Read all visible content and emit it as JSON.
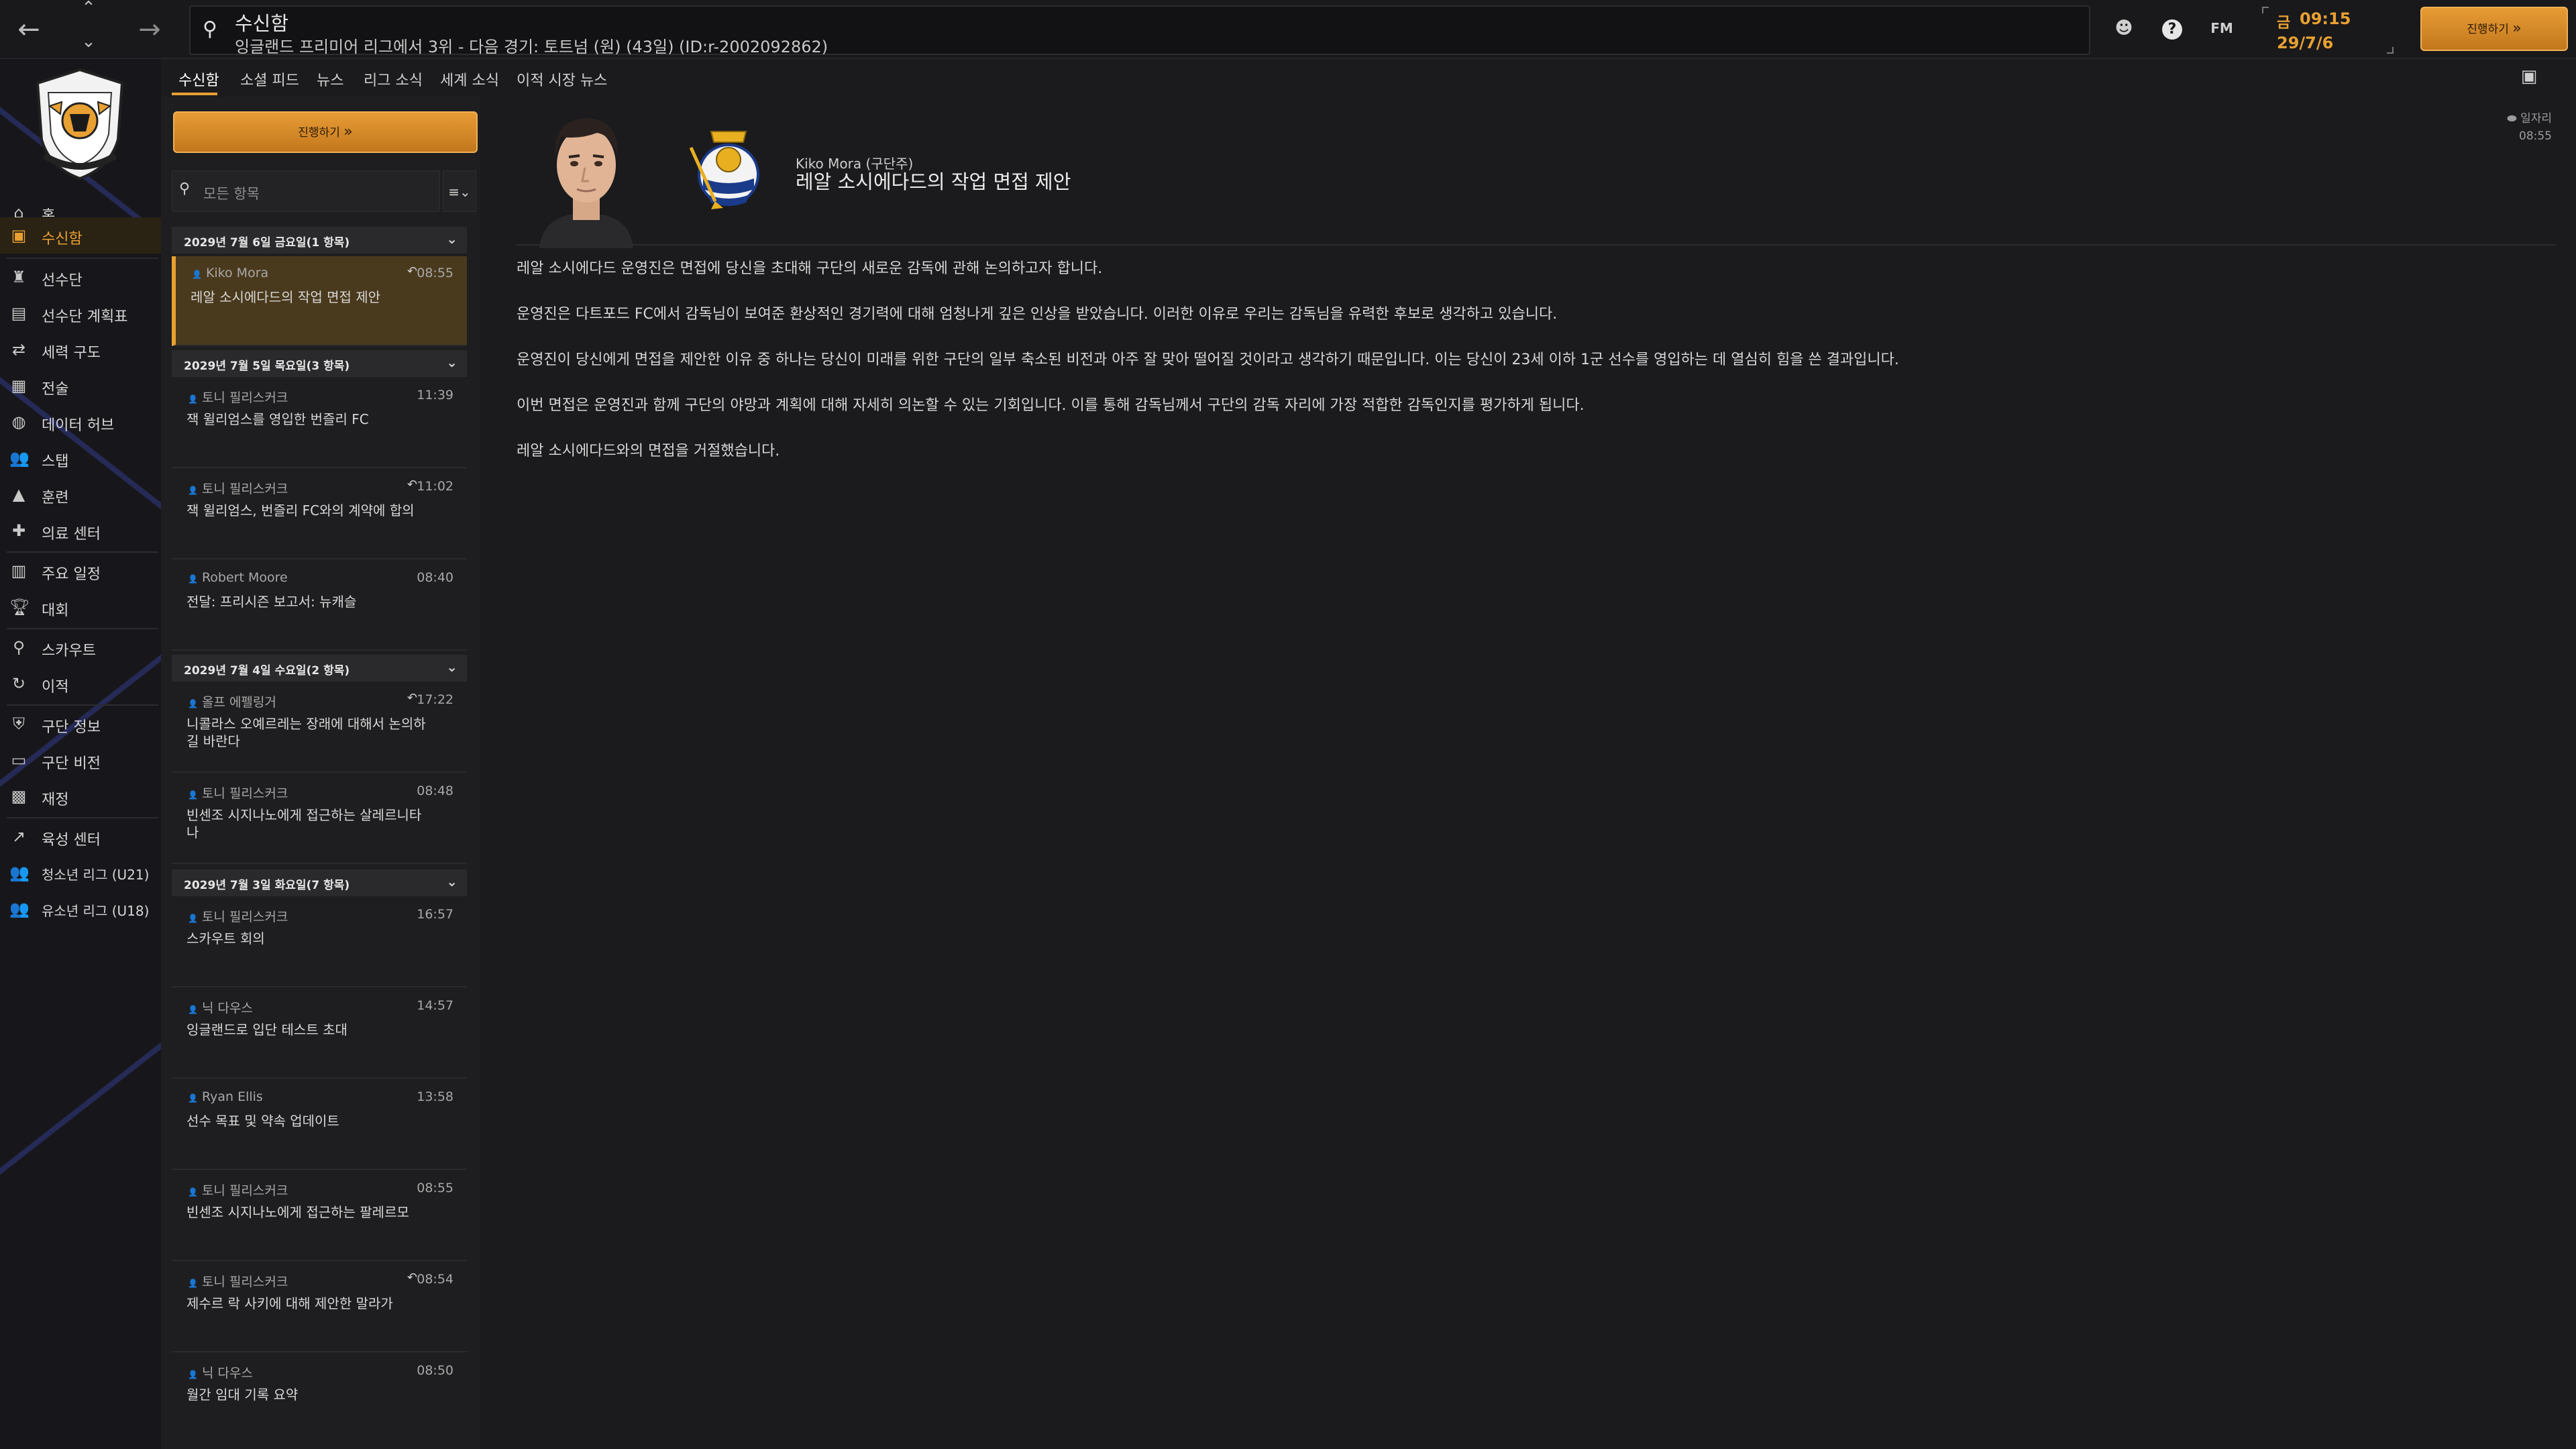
{
  "header": {
    "title": "수신함",
    "subtitle": "잉글랜드 프리미어 리그에서 3위 - 다음 경기: 토트넘 (원) (43일) (ID:r-2002092862)",
    "fm_label": "FM",
    "day": "금",
    "time": "09:15",
    "date": "29/7/6",
    "continue_label": "진행하기"
  },
  "sidebar": {
    "items": [
      {
        "label": "홈",
        "icon": "home-icon"
      },
      {
        "label": "수신함",
        "icon": "inbox-icon"
      },
      {
        "label": "선수단",
        "icon": "shirt-icon"
      },
      {
        "label": "선수단 계획표",
        "icon": "clipboard-icon"
      },
      {
        "label": "세력 구도",
        "icon": "hierarchy-icon"
      },
      {
        "label": "전술",
        "icon": "tactics-icon"
      },
      {
        "label": "데이터 허브",
        "icon": "data-hub-icon"
      },
      {
        "label": "스탭",
        "icon": "staff-icon"
      },
      {
        "label": "훈련",
        "icon": "training-icon"
      },
      {
        "label": "의료 센터",
        "icon": "medical-icon"
      },
      {
        "label": "주요 일정",
        "icon": "calendar-icon"
      },
      {
        "label": "대회",
        "icon": "trophy-icon"
      },
      {
        "label": "스카우트",
        "icon": "scouting-icon"
      },
      {
        "label": "이적",
        "icon": "transfer-icon"
      },
      {
        "label": "구단 정보",
        "icon": "shield-icon"
      },
      {
        "label": "구단 비전",
        "icon": "briefcase-icon"
      },
      {
        "label": "재정",
        "icon": "finance-icon"
      },
      {
        "label": "육성 센터",
        "icon": "development-icon"
      },
      {
        "label": "청소년 리그 (U21)",
        "icon": "u21-icon"
      },
      {
        "label": "유소년 리그 (U18)",
        "icon": "u18-icon"
      }
    ]
  },
  "tabs": [
    "수신함",
    "소셜 피드",
    "뉴스",
    "리그 소식",
    "세계 소식",
    "이적 시장 뉴스"
  ],
  "list": {
    "continue_label": "진행하기",
    "filter_placeholder": "모든 항목",
    "groups": [
      {
        "header": "2029년 7월 6일 금요일(1 항목)",
        "messages": [
          {
            "sender": "Kiko Mora",
            "time": "08:55",
            "subject": "레알 소시에다드의 작업 면접 제안",
            "reply": true
          }
        ]
      },
      {
        "header": "2029년 7월 5일 목요일(3 항목)",
        "messages": [
          {
            "sender": "토니 필리스커크",
            "time": "11:39",
            "subject": "잭 윌리엄스를 영입한 번즐리 FC",
            "reply": false
          },
          {
            "sender": "토니 필리스커크",
            "time": "11:02",
            "subject": "잭 윌리엄스, 번즐리 FC와의 계약에 합의",
            "reply": true
          },
          {
            "sender": "Robert Moore",
            "time": "08:40",
            "subject": "전달: 프리시즌 보고서: 뉴캐슬",
            "reply": false
          }
        ]
      },
      {
        "header": "2029년 7월 4일 수요일(2 항목)",
        "messages": [
          {
            "sender": "올프 에펠링거",
            "time": "17:22",
            "subject": "니콜라스 오예르레는 장래에 대해서 논의하길 바란다",
            "reply": true
          },
          {
            "sender": "토니 필리스커크",
            "time": "08:48",
            "subject": "빈센조 시지나노에게 접근하는 살레르니타나",
            "reply": false
          }
        ]
      },
      {
        "header": "2029년 7월 3일 화요일(7 항목)",
        "messages": [
          {
            "sender": "토니 필리스커크",
            "time": "16:57",
            "subject": "스카우트 회의",
            "reply": false
          },
          {
            "sender": "닉 다우스",
            "time": "14:57",
            "subject": "잉글랜드로 입단 테스트 초대",
            "reply": false
          },
          {
            "sender": "Ryan Ellis",
            "time": "13:58",
            "subject": "선수 목표 및 약속 업데이트",
            "reply": false
          },
          {
            "sender": "토니 필리스커크",
            "time": "08:55",
            "subject": "빈센조 시지나노에게 접근하는 팔레르모",
            "reply": false
          },
          {
            "sender": "토니 필리스커크",
            "time": "08:54",
            "subject": "제수르 락 사키에 대해 제안한 말라가",
            "reply": true
          },
          {
            "sender": "닉 다우스",
            "time": "08:50",
            "subject": "월간 임대 기록 요약",
            "reply": false
          }
        ]
      }
    ]
  },
  "mail": {
    "from": "Kiko Mora (구단주)",
    "title": "레알 소시에다드의 작업 면접 제안",
    "meta_label": "일자리",
    "meta_time": "08:55",
    "paragraphs": [
      "레알 소시에다드 운영진은 면접에 당신을 초대해 구단의 새로운 감독에 관해 논의하고자 합니다.",
      "운영진은 다트포드 FC에서 감독님이 보여준 환상적인 경기력에 대해 엄청나게 깊은 인상을 받았습니다. 이러한 이유로 우리는 감독님을 유력한 후보로 생각하고 있습니다.",
      "운영진이 당신에게 면접을 제안한 이유 중 하나는 당신이 미래를 위한 구단의 일부 축소된 비전과 아주 잘 맞아 떨어질 것이라고 생각하기 때문입니다. 이는 당신이 23세 이하 1군 선수를 영입하는 데 열심히 힘을 쓴 결과입니다.",
      "이번 면접은 운영진과 함께 구단의 야망과 계획에 대해 자세히 의논할 수 있는 기회입니다. 이를 통해 감독님께서 구단의 감독 자리에 가장 적합한 감독인지를 평가하게 됩니다.",
      "레알 소시에다드와의 면접을 거절했습니다."
    ]
  },
  "colors": {
    "accent": "#e8a033",
    "background": "#1b1b1d",
    "sidebar": "#17171b",
    "stripe": "#2e3370"
  }
}
